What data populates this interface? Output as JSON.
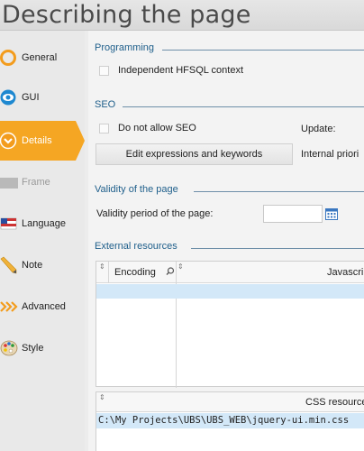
{
  "window": {
    "title": "Describing the page"
  },
  "sidebar": {
    "items": [
      {
        "label": "General",
        "icon": "circle-ring-icon",
        "state": "normal"
      },
      {
        "label": "GUI",
        "icon": "eye-icon",
        "state": "normal"
      },
      {
        "label": "Details",
        "icon": "chevron-down-icon",
        "state": "active"
      },
      {
        "label": "Frame",
        "icon": "frame-icon",
        "state": "disabled"
      },
      {
        "label": "Language",
        "icon": "flag-icon",
        "state": "normal"
      },
      {
        "label": "Note",
        "icon": "pencil-icon",
        "state": "normal"
      },
      {
        "label": "Advanced",
        "icon": "double-chevron-icon",
        "state": "normal"
      },
      {
        "label": "Style",
        "icon": "palette-icon",
        "state": "normal"
      }
    ]
  },
  "programming": {
    "title": "Programming",
    "independent_context_label": "Independent HFSQL context",
    "independent_context_checked": false
  },
  "seo": {
    "title": "SEO",
    "no_seo_label": "Do not allow SEO",
    "no_seo_checked": false,
    "update_label": "Update:",
    "edit_button": "Edit expressions and keywords",
    "internal_priority_label": "Internal priori"
  },
  "validity": {
    "title": "Validity of the page",
    "period_label": "Validity period of the page:",
    "period_value": ""
  },
  "external": {
    "title": "External resources",
    "js_table": {
      "columns": [
        "Encoding",
        "Javascri"
      ],
      "rows": []
    },
    "css_table": {
      "columns": [
        "CSS resources"
      ],
      "rows": [
        "C:\\My Projects\\UBS\\UBS_WEB\\jquery-ui.min.css"
      ]
    }
  },
  "colors": {
    "accent": "#f5a623",
    "section_title": "#1f5f8b",
    "selection": "#d3e8f8"
  }
}
